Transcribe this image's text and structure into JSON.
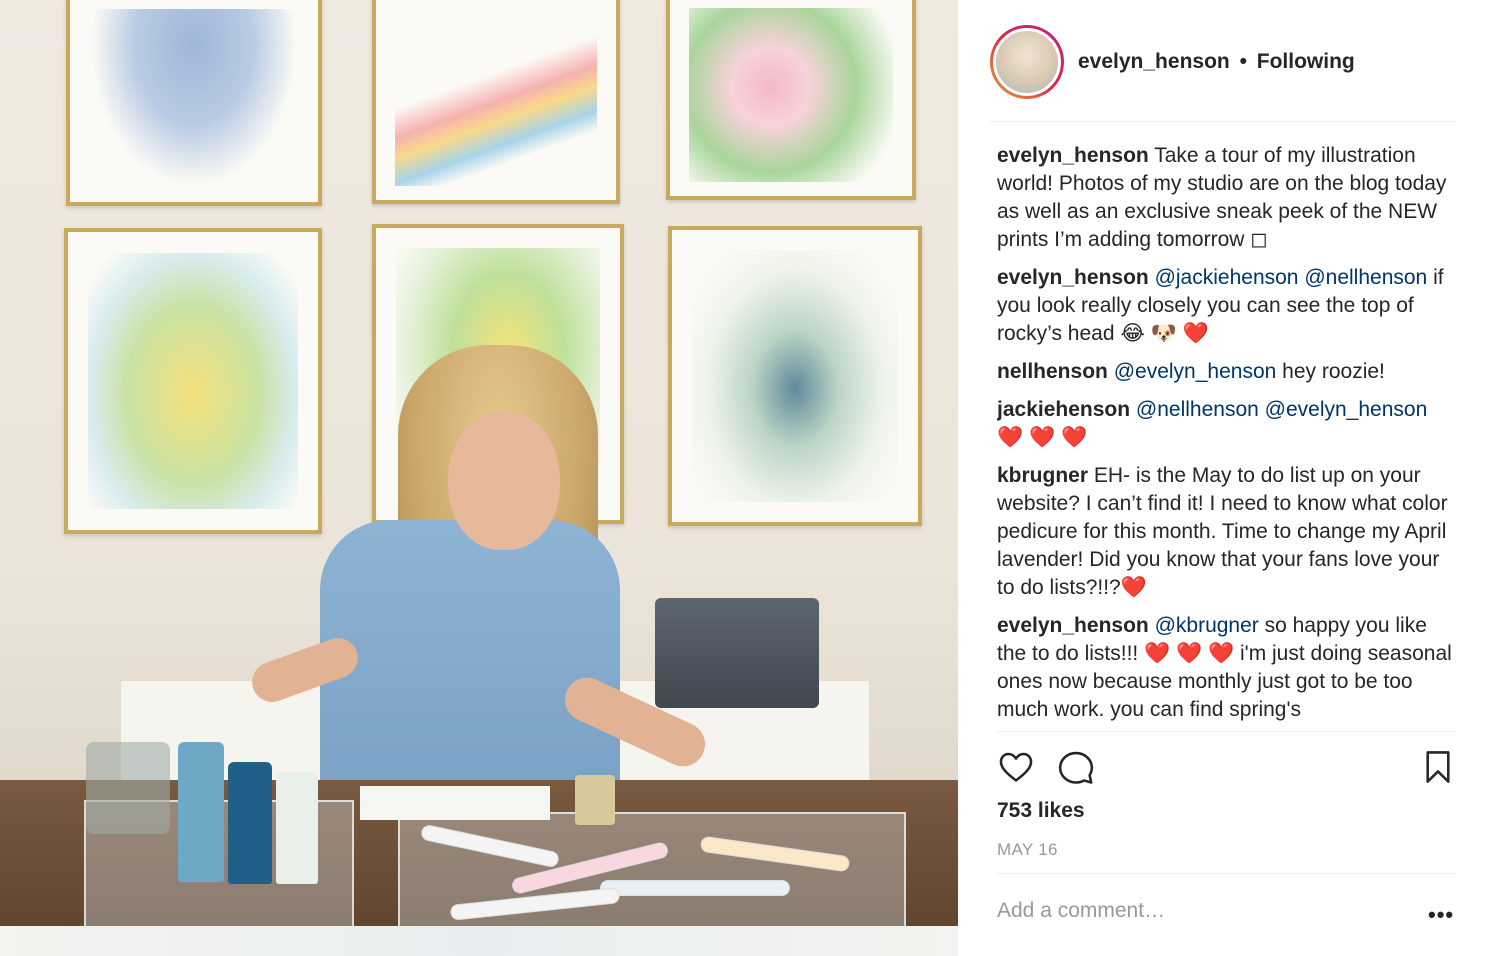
{
  "post": {
    "username": "evelyn_henson",
    "follow_status": "Following",
    "separator": "•"
  },
  "caption": {
    "user": "evelyn_henson",
    "text": " Take a tour of my illustration world! Photos of my studio are on the blog today as well as an exclusive sneak peek of the NEW prints I’m adding tomorrow ◻"
  },
  "comments": [
    {
      "user": "evelyn_henson",
      "mentions": [
        "@jackiehenson",
        "@nellhenson"
      ],
      "text": "if you look really closely you can see the top of rocky’s head 😂 🐶 ❤️"
    },
    {
      "user": "nellhenson",
      "mentions": [
        "@evelyn_henson"
      ],
      "text": " hey roozie!"
    },
    {
      "user": "jackiehenson",
      "mentions": [
        "@nellhenson",
        "@evelyn_henson"
      ],
      "text": "❤️ ❤️ ❤️"
    },
    {
      "user": "kbrugner",
      "mentions": [],
      "text": " EH- is the May to do list up on your website? I can’t find it! I need to know what color pedicure for this month. Time to change my April lavender! Did you know that your fans love your to do lists?!!?❤️"
    },
    {
      "user": "evelyn_henson",
      "mentions": [
        "@kbrugner"
      ],
      "text": " so happy you like the to do lists!!! ❤️ ❤️ ❤️  i'm just doing seasonal ones now because monthly just got to be too much work. you can find spring's"
    }
  ],
  "stats": {
    "likes": "753 likes",
    "date": "MAY 16"
  },
  "composer": {
    "placeholder": "Add a comment…",
    "more": "•••"
  },
  "icons": {
    "like": "heart-outline-icon",
    "comment": "speech-bubble-icon",
    "save": "bookmark-icon"
  },
  "colors": {
    "mention": "#003569",
    "heart": "#e0172a",
    "muted": "#999999",
    "text": "#262626",
    "frame_gold": "#c9a95c"
  }
}
